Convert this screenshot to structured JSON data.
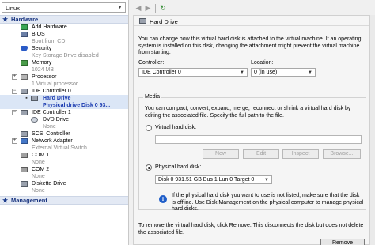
{
  "vm_selector": {
    "value": "Linux"
  },
  "tree": {
    "hardware_header": "Hardware",
    "management_header": "Management",
    "items": [
      {
        "label": "Add Hardware",
        "sub": ""
      },
      {
        "label": "BIOS",
        "sub": "Boot from CD"
      },
      {
        "label": "Security",
        "sub": "Key Storage Drive disabled"
      },
      {
        "label": "Memory",
        "sub": "1024 MB"
      },
      {
        "label": "Processor",
        "sub": "1 Virtual processor"
      },
      {
        "label": "IDE Controller 0",
        "sub": ""
      },
      {
        "label": "Hard Drive",
        "sub": "Physical drive Disk 0 93..."
      },
      {
        "label": "IDE Controller 1",
        "sub": ""
      },
      {
        "label": "DVD Drive",
        "sub": "None"
      },
      {
        "label": "SCSI Controller",
        "sub": ""
      },
      {
        "label": "Network Adapter",
        "sub": "External Virtual Switch"
      },
      {
        "label": "COM 1",
        "sub": "None"
      },
      {
        "label": "COM 2",
        "sub": "None"
      },
      {
        "label": "Diskette Drive",
        "sub": "None"
      }
    ]
  },
  "panel": {
    "title": "Hard Drive",
    "description": "You can change how this virtual hard disk is attached to the virtual machine. If an operating system is installed on this disk, changing the attachment might prevent the virtual machine from starting.",
    "controller_label": "Controller:",
    "controller_value": "IDE Controller 0",
    "location_label": "Location:",
    "location_value": "0 (in use)",
    "media_legend": "Media",
    "media_description": "You can compact, convert, expand, merge, reconnect or shrink a virtual hard disk by editing the associated file. Specify the full path to the file.",
    "vhd_radio_label": "Virtual hard disk:",
    "vhd_value": "",
    "buttons": {
      "new": "New",
      "edit": "Edit",
      "inspect": "Inspect",
      "browse": "Browse..."
    },
    "phd_radio_label": "Physical hard disk:",
    "phd_value": "Disk 0 931.51 GB Bus 1 Lun 0 Target 0",
    "info_text": "If the physical hard disk you want to use is not listed, make sure that the disk is offline. Use Disk Management on the physical computer to manage physical hard disks.",
    "remove_description": "To remove the virtual hard disk, click Remove. This disconnects the disk but does not delete the associated file.",
    "remove_label": "Remove"
  },
  "colors": {
    "header_text": "#17337f",
    "selected_text": "#1b3bb0",
    "header_bg": "#e3e9f4"
  }
}
